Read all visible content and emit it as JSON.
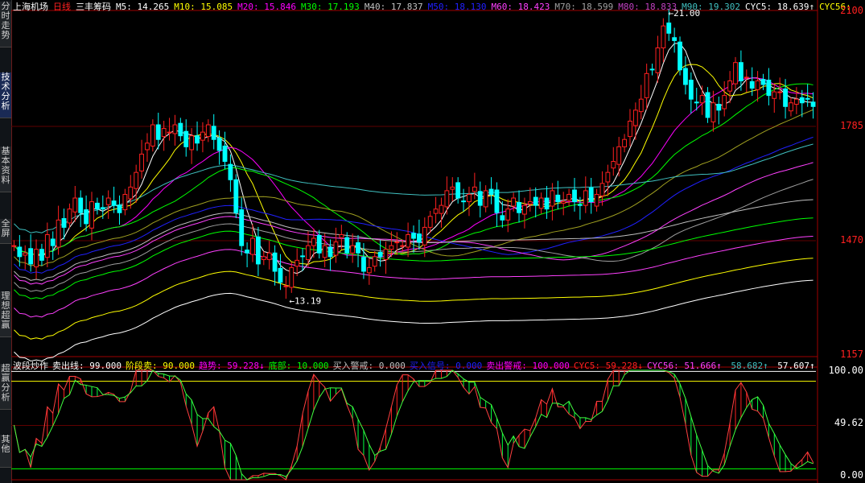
{
  "header": {
    "stock_name": "上海机场",
    "period": "日线",
    "method": "三丰筹码",
    "ma_values": [
      {
        "label": "M5:",
        "value": "14.265",
        "color": "#ffffff"
      },
      {
        "label": "M10:",
        "value": "15.085",
        "color": "#ffff00"
      },
      {
        "label": "M20:",
        "value": "15.846",
        "color": "#ff00ff"
      },
      {
        "label": "M30:",
        "value": "17.193",
        "color": "#00ff00"
      },
      {
        "label": "M40:",
        "value": "17.837",
        "color": "#c0c0c0"
      },
      {
        "label": "M50:",
        "value": "18.130",
        "color": "#2020ff"
      },
      {
        "label": "M60:",
        "value": "18.423",
        "color": "#ff40ff"
      },
      {
        "label": "M70:",
        "value": "18.599",
        "color": "#a0a0a0"
      },
      {
        "label": "M80:",
        "value": "18.833",
        "color": "#c040c0"
      },
      {
        "label": "M90:",
        "value": "19.302",
        "color": "#40c0c0"
      },
      {
        "label": "CYC5:",
        "value": "18.639",
        "color": "#ffffff",
        "arrow": "↑"
      },
      {
        "label": "CYC56:",
        "value": "",
        "color": "#ffff00"
      }
    ]
  },
  "sidebar": {
    "tabs": [
      {
        "label": "分时走势",
        "active": false
      },
      {
        "label": "技术分析",
        "active": true
      },
      {
        "label": "基本资料",
        "active": false
      },
      {
        "label": "全屏",
        "active": false
      },
      {
        "label": "理想超赢",
        "active": false
      },
      {
        "label": "超赢分析",
        "active": false
      },
      {
        "label": "其他",
        "active": false
      }
    ]
  },
  "price_axis": {
    "ticks": [
      "2100",
      "1785",
      "1470",
      "1157"
    ]
  },
  "indicator_axis": {
    "ticks": [
      "100.00",
      "49.62",
      "0.00"
    ]
  },
  "annotations": {
    "high_label": "21.00",
    "low_label": "13.19"
  },
  "indicator": {
    "name": "波段炒作",
    "items": [
      {
        "label": "卖出线:",
        "value": "99.000",
        "color": "#ffffff"
      },
      {
        "label": "阶段卖:",
        "value": "90.000",
        "color": "#ffff00"
      },
      {
        "label": "趋势:",
        "value": "59.228",
        "color": "#ff00ff",
        "arrow": "↓"
      },
      {
        "label": "底部:",
        "value": "10.000",
        "color": "#00ff00"
      },
      {
        "label": "买入警戒:",
        "value": "0.000",
        "color": "#c0c0c0"
      },
      {
        "label": "买入信号:",
        "value": "0.000",
        "color": "#2020ff"
      },
      {
        "label": "卖出警戒:",
        "value": "100.000",
        "color": "#ff00ff"
      },
      {
        "label": "CYC5:",
        "value": "59.228",
        "color": "#ff2020",
        "arrow": "↓"
      },
      {
        "label": "CYC56:",
        "value": "51.666",
        "color": "#ff40ff",
        "arrow": "↑"
      },
      {
        "label": "",
        "value": "58.682",
        "color": "#40c0c0",
        "arrow": "↑"
      },
      {
        "label": "",
        "value": "57.607",
        "color": "#ffffff",
        "arrow": "↑"
      }
    ]
  },
  "colors": {
    "up": "#ff2020",
    "down": "#00ffff",
    "frame": "#a00000"
  },
  "chart_data": {
    "type": "candlestick",
    "price_range": [
      11.57,
      21.0
    ],
    "closes": [
      14.6,
      14.3,
      14.4,
      14.1,
      14.5,
      14.2,
      14.9,
      14.6,
      15.3,
      15.1,
      15.6,
      15.9,
      15.5,
      15.2,
      15.8,
      15.6,
      15.6,
      15.9,
      15.7,
      15.5,
      16.0,
      16.2,
      16.6,
      17.1,
      17.4,
      17.9,
      17.5,
      17.8,
      17.7,
      17.9,
      17.6,
      17.3,
      17.6,
      17.4,
      17.7,
      17.9,
      17.5,
      17.2,
      16.9,
      16.4,
      15.5,
      14.6,
      14.4,
      14.8,
      14.1,
      14.3,
      14.4,
      13.9,
      13.6,
      13.5,
      14.0,
      14.2,
      14.3,
      14.6,
      14.8,
      14.4,
      14.6,
      14.3,
      14.7,
      14.9,
      14.4,
      14.6,
      14.4,
      13.9,
      14.0,
      14.3,
      14.3,
      14.5,
      14.6,
      14.7,
      14.6,
      14.9,
      14.8,
      14.7,
      15.1,
      15.4,
      15.6,
      15.7,
      16.1,
      16.2,
      15.9,
      15.8,
      16.0,
      16.2,
      15.7,
      16.1,
      16.0,
      15.5,
      15.3,
      15.6,
      15.9,
      15.5,
      15.7,
      15.8,
      15.7,
      15.9,
      15.6,
      16.1,
      15.8,
      15.8,
      16.0,
      15.8,
      15.7,
      16.1,
      15.8,
      16.0,
      16.3,
      16.6,
      16.9,
      17.3,
      17.5,
      18.0,
      18.3,
      18.6,
      19.3,
      19.4,
      20.0,
      20.6,
      20.4,
      20.2,
      19.4,
      19.0,
      18.6,
      18.5,
      18.7,
      18.1,
      18.5,
      18.3,
      18.7,
      19.1,
      19.6,
      19.1,
      19.2,
      18.9,
      19.1,
      19.0,
      18.7,
      18.8,
      18.8,
      18.4,
      18.5,
      18.6,
      18.5,
      18.6,
      18.4
    ]
  }
}
